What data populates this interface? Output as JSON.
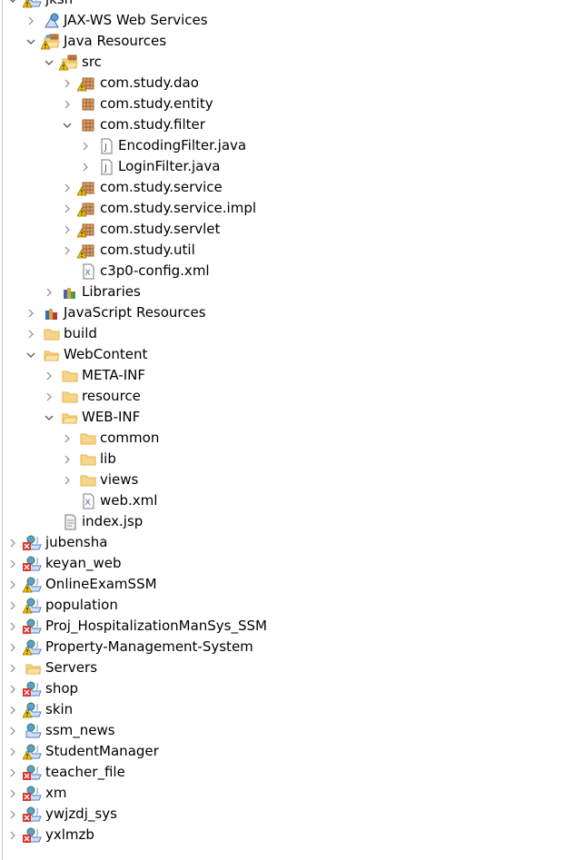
{
  "colors": {
    "folder": "#e8b34a",
    "package": "#a0622d",
    "project": "#4f7fbf",
    "warning": "#f2c200",
    "error": "#d9342b",
    "arrow": "#8a8a8a"
  },
  "tree": [
    {
      "label": "jksn",
      "level": 0,
      "expanded": true,
      "icon": "project-icon",
      "marker": "warning"
    },
    {
      "label": "JAX-WS Web Services",
      "level": 1,
      "expanded": false,
      "icon": "web-services-icon",
      "marker": ""
    },
    {
      "label": "Java Resources",
      "level": 1,
      "expanded": true,
      "icon": "java-resources-icon",
      "marker": "warning"
    },
    {
      "label": "src",
      "level": 2,
      "expanded": true,
      "icon": "source-folder-icon",
      "marker": "warning"
    },
    {
      "label": "com.study.dao",
      "level": 3,
      "expanded": false,
      "icon": "package-icon",
      "marker": "warning"
    },
    {
      "label": "com.study.entity",
      "level": 3,
      "expanded": false,
      "icon": "package-icon",
      "marker": ""
    },
    {
      "label": "com.study.filter",
      "level": 3,
      "expanded": true,
      "icon": "package-icon",
      "marker": ""
    },
    {
      "label": "EncodingFilter.java",
      "level": 4,
      "expanded": false,
      "icon": "java-file-icon",
      "marker": ""
    },
    {
      "label": "LoginFilter.java",
      "level": 4,
      "expanded": false,
      "icon": "java-file-icon",
      "marker": ""
    },
    {
      "label": "com.study.service",
      "level": 3,
      "expanded": false,
      "icon": "package-icon",
      "marker": "warning"
    },
    {
      "label": "com.study.service.impl",
      "level": 3,
      "expanded": false,
      "icon": "package-icon",
      "marker": "warning"
    },
    {
      "label": "com.study.servlet",
      "level": 3,
      "expanded": false,
      "icon": "package-icon",
      "marker": "warning"
    },
    {
      "label": "com.study.util",
      "level": 3,
      "expanded": false,
      "icon": "package-icon",
      "marker": "warning"
    },
    {
      "label": "c3p0-config.xml",
      "level": 3,
      "leaf": true,
      "icon": "xml-file-icon",
      "marker": ""
    },
    {
      "label": "Libraries",
      "level": 2,
      "expanded": false,
      "icon": "libraries-icon",
      "marker": ""
    },
    {
      "label": "JavaScript Resources",
      "level": 1,
      "expanded": false,
      "icon": "javascript-resources-icon",
      "marker": ""
    },
    {
      "label": "build",
      "level": 1,
      "expanded": false,
      "icon": "folder-icon",
      "marker": ""
    },
    {
      "label": "WebContent",
      "level": 1,
      "expanded": true,
      "icon": "folder-open-icon",
      "marker": ""
    },
    {
      "label": "META-INF",
      "level": 2,
      "expanded": false,
      "icon": "folder-icon",
      "marker": ""
    },
    {
      "label": "resource",
      "level": 2,
      "expanded": false,
      "icon": "folder-icon",
      "marker": ""
    },
    {
      "label": "WEB-INF",
      "level": 2,
      "expanded": true,
      "icon": "folder-open-icon",
      "marker": ""
    },
    {
      "label": "common",
      "level": 3,
      "expanded": false,
      "icon": "folder-icon",
      "marker": ""
    },
    {
      "label": "lib",
      "level": 3,
      "expanded": false,
      "icon": "folder-icon",
      "marker": ""
    },
    {
      "label": "views",
      "level": 3,
      "expanded": false,
      "icon": "folder-icon",
      "marker": ""
    },
    {
      "label": "web.xml",
      "level": 3,
      "leaf": true,
      "icon": "xml-file-icon",
      "marker": ""
    },
    {
      "label": "index.jsp",
      "level": 2,
      "leaf": true,
      "icon": "jsp-file-icon",
      "marker": ""
    },
    {
      "label": "jubensha",
      "level": 0,
      "expanded": false,
      "icon": "project-icon",
      "marker": "error"
    },
    {
      "label": "keyan_web",
      "level": 0,
      "expanded": false,
      "icon": "project-icon",
      "marker": "error"
    },
    {
      "label": "OnlineExamSSM",
      "level": 0,
      "expanded": false,
      "icon": "project-icon",
      "marker": "warning"
    },
    {
      "label": "population",
      "level": 0,
      "expanded": false,
      "icon": "project-icon",
      "marker": "warning"
    },
    {
      "label": "Proj_HospitalizationManSys_SSM",
      "level": 0,
      "expanded": false,
      "icon": "project-icon",
      "marker": "error"
    },
    {
      "label": "Property-Management-System",
      "level": 0,
      "expanded": false,
      "icon": "project-icon",
      "marker": "warning"
    },
    {
      "label": "Servers",
      "level": 0,
      "expanded": false,
      "icon": "folder-open-icon",
      "marker": ""
    },
    {
      "label": "shop",
      "level": 0,
      "expanded": false,
      "icon": "project-icon",
      "marker": "error"
    },
    {
      "label": "skin",
      "level": 0,
      "expanded": false,
      "icon": "project-icon",
      "marker": "warning"
    },
    {
      "label": "ssm_news",
      "level": 0,
      "expanded": false,
      "icon": "project-icon",
      "marker": ""
    },
    {
      "label": "StudentManager",
      "level": 0,
      "expanded": false,
      "icon": "project-icon",
      "marker": "warning"
    },
    {
      "label": "teacher_file",
      "level": 0,
      "expanded": false,
      "icon": "project-icon",
      "marker": "error"
    },
    {
      "label": "xm",
      "level": 0,
      "expanded": false,
      "icon": "project-icon",
      "marker": "error"
    },
    {
      "label": "ywjzdj_sys",
      "level": 0,
      "expanded": false,
      "icon": "project-icon",
      "marker": "error"
    },
    {
      "label": "yxlmzb",
      "level": 0,
      "expanded": false,
      "icon": "project-icon",
      "marker": "error"
    }
  ]
}
